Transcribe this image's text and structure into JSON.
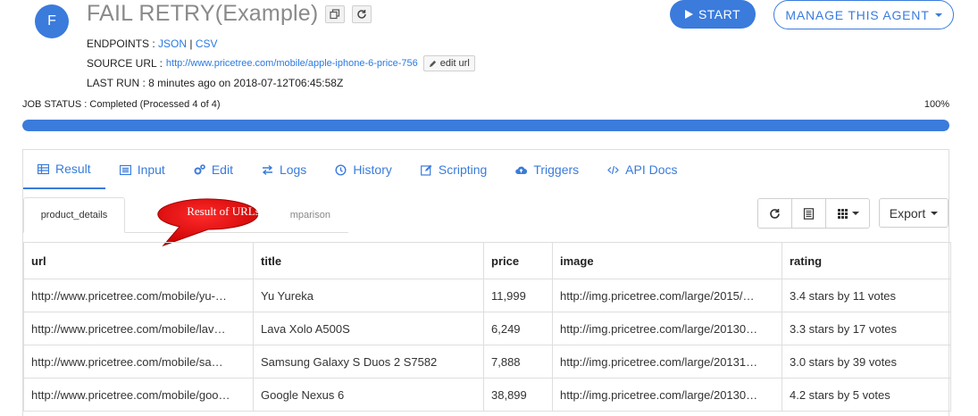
{
  "avatar": {
    "letter": "F"
  },
  "agent": {
    "title": "FAIL RETRY(Example)"
  },
  "endpoints": {
    "label": "ENDPOINTS : ",
    "json": "JSON",
    "sep": " | ",
    "csv": "CSV"
  },
  "source": {
    "label": "SOURCE URL : ",
    "url": "http://www.pricetree.com/mobile/apple-iphone-6-price-756",
    "edit_label": "edit url"
  },
  "last_run": {
    "text": "LAST RUN : 8 minutes ago on 2018-07-12T06:45:58Z"
  },
  "buttons": {
    "start": "START",
    "manage": "MANAGE THIS AGENT"
  },
  "job": {
    "status": "JOB STATUS : Completed (Processed 4 of 4)",
    "percent": "100%",
    "progress": 100
  },
  "tabs": [
    {
      "label": "Result",
      "icon": "table-icon"
    },
    {
      "label": "Input",
      "icon": "list-icon"
    },
    {
      "label": "Edit",
      "icon": "gears-icon"
    },
    {
      "label": "Logs",
      "icon": "exchange-icon"
    },
    {
      "label": "History",
      "icon": "clock-icon"
    },
    {
      "label": "Scripting",
      "icon": "pencil-icon"
    },
    {
      "label": "Triggers",
      "icon": "cloud-upload-icon"
    },
    {
      "label": "API Docs",
      "icon": "code-icon"
    }
  ],
  "subtabs": {
    "active": "product_details",
    "inactive": "mparison"
  },
  "callout": {
    "text": "Result of URLs",
    "color": "#e00000"
  },
  "toolbar": {
    "export": "Export"
  },
  "colors": {
    "accent": "#3a7bdc"
  },
  "table": {
    "columns": [
      "url",
      "title",
      "price",
      "image",
      "rating"
    ],
    "rows": [
      [
        "http://www.pricetree.com/mobile/yu-…",
        "Yu Yureka",
        "11,999",
        "http://img.pricetree.com/large/2015/…",
        "3.4 stars by 11 votes"
      ],
      [
        "http://www.pricetree.com/mobile/lav…",
        "Lava Xolo A500S",
        "6,249",
        "http://img.pricetree.com/large/20130…",
        "3.3 stars by 17 votes"
      ],
      [
        "http://www.pricetree.com/mobile/sa…",
        "Samsung Galaxy S Duos 2 S7582",
        "7,888",
        "http://img.pricetree.com/large/20131…",
        "3.0 stars by 39 votes"
      ],
      [
        "http://www.pricetree.com/mobile/goo…",
        "Google Nexus 6",
        "38,899",
        "http://img.pricetree.com/large/20130…",
        "4.2 stars by 5 votes"
      ]
    ]
  }
}
